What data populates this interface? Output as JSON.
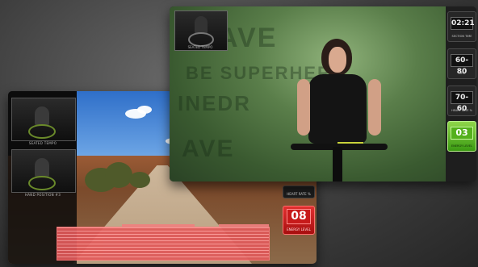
{
  "back_screen": {
    "thumbnails": [
      {
        "label": "SEATED TEMPO"
      },
      {
        "label": "HAND POSITION #3"
      }
    ],
    "heart_rate_label": "HEART RATE %",
    "energy_value": "08",
    "energy_label": "ENERGY LEVEL"
  },
  "front_screen": {
    "preview_label": "SEATED TEMPO",
    "background_words": [
      "AVE",
      "BE SUPERHERO",
      "INEDR",
      "AVE"
    ],
    "metrics": [
      {
        "value": "02:21",
        "label": "SECTION TIME"
      },
      {
        "value": "60-80",
        "label": "RPM"
      },
      {
        "value": "70-60",
        "label": "HEART RATE %"
      },
      {
        "value": "03",
        "label": "ENERGY LEVEL"
      }
    ]
  },
  "colors": {
    "energy_red": "#c71a1a",
    "energy_green": "#54b01c",
    "profile_pink": "#ff9a9a"
  }
}
